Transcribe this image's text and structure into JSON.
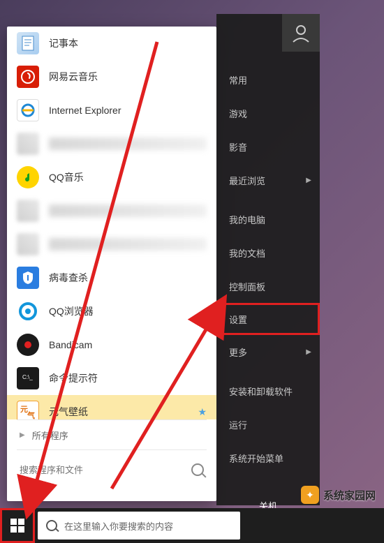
{
  "programs": [
    {
      "label": "记事本",
      "icon": "notepad-icon"
    },
    {
      "label": "网易云音乐",
      "icon": "netease-music-icon"
    },
    {
      "label": "Internet Explorer",
      "icon": "ie-icon"
    },
    {
      "label": "",
      "icon": "blurred",
      "blurred": true
    },
    {
      "label": "QQ音乐",
      "icon": "qq-music-icon"
    },
    {
      "label": "",
      "icon": "blurred",
      "blurred": true
    },
    {
      "label": "",
      "icon": "blurred",
      "blurred": true
    },
    {
      "label": "病毒查杀",
      "icon": "shield-icon"
    },
    {
      "label": "QQ浏览器",
      "icon": "qq-browser-icon"
    },
    {
      "label": "Bandicam",
      "icon": "bandicam-icon"
    },
    {
      "label": "命令提示符",
      "icon": "cmd-icon"
    },
    {
      "label": "元气壁纸",
      "icon": "yuanqi-icon",
      "starred": true,
      "selected": true
    }
  ],
  "all_programs_label": "所有程序",
  "search_placeholder": "搜索程序和文件",
  "right_panel": [
    {
      "label": "常用"
    },
    {
      "label": "游戏"
    },
    {
      "label": "影音"
    },
    {
      "label": "最近浏览",
      "has_submenu": true
    },
    {
      "sep": true
    },
    {
      "label": "我的电脑"
    },
    {
      "label": "我的文档"
    },
    {
      "label": "控制面板"
    },
    {
      "label": "设置",
      "highlighted": true
    },
    {
      "label": "更多",
      "has_submenu": true
    },
    {
      "sep": true
    },
    {
      "label": "安装和卸载软件"
    },
    {
      "label": "运行"
    },
    {
      "label": "系统开始菜单"
    }
  ],
  "shutdown_label": "关机",
  "taskbar_search_placeholder": "在这里输入你要搜索的内容",
  "watermark_text": "系统家园网",
  "colors": {
    "highlight_border": "#e02020",
    "panel_bg": "#1c1c1c"
  }
}
